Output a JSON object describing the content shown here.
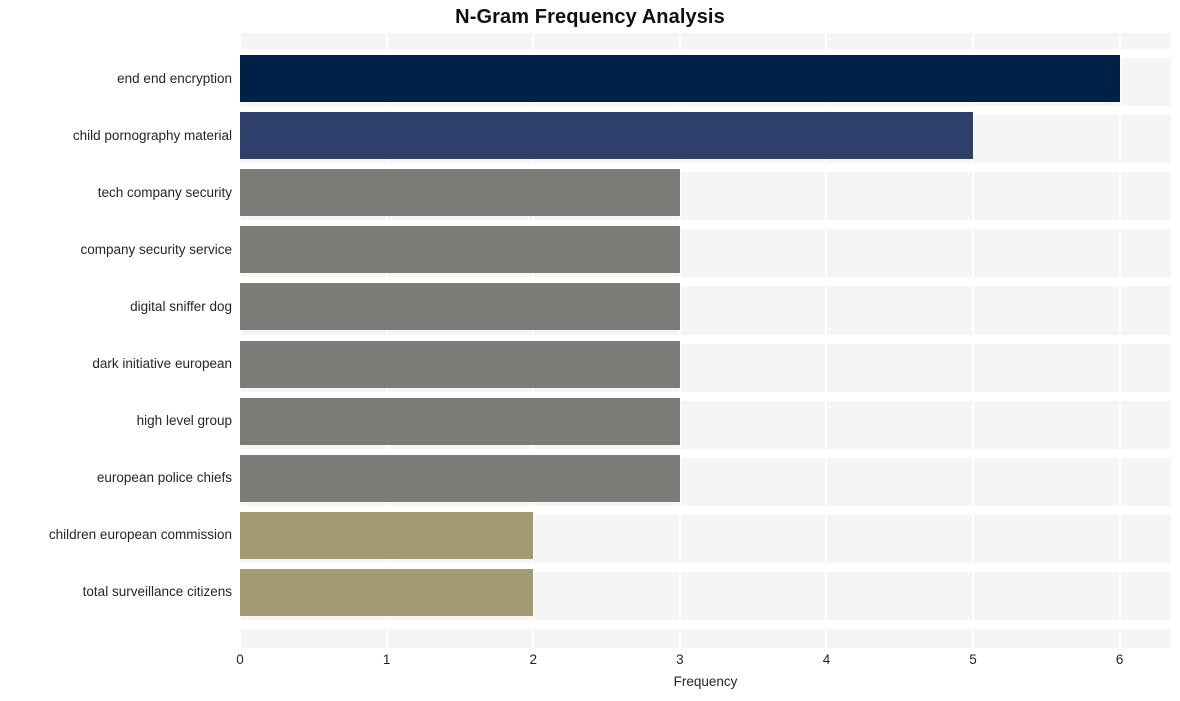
{
  "chart_data": {
    "type": "bar",
    "orientation": "horizontal",
    "title": "N-Gram Frequency Analysis",
    "xlabel": "Frequency",
    "ylabel": "",
    "xlim": [
      0,
      6.35
    ],
    "xticks": [
      0,
      1,
      2,
      3,
      4,
      5,
      6
    ],
    "xtick_labels": [
      "0",
      "1",
      "2",
      "3",
      "4",
      "5",
      "6"
    ],
    "grid": true,
    "legend": "none",
    "categories": [
      "end end encryption",
      "child pornography material",
      "tech company security",
      "company security service",
      "digital sniffer dog",
      "dark initiative european",
      "high level group",
      "european police chiefs",
      "children european commission",
      "total surveillance citizens"
    ],
    "values": [
      6,
      5,
      3,
      3,
      3,
      3,
      3,
      3,
      2,
      2
    ],
    "bar_colors": [
      "#002147",
      "#2e3f6b",
      "#7b7b78",
      "#7b7b78",
      "#7b7b78",
      "#7b7b78",
      "#7b7b78",
      "#7b7b78",
      "#a39a72",
      "#a39a72"
    ],
    "plot_background": "#f5f5f5",
    "grid_color": "#ffffff",
    "figure_background": "#ffffff",
    "text_color": "#262626"
  }
}
